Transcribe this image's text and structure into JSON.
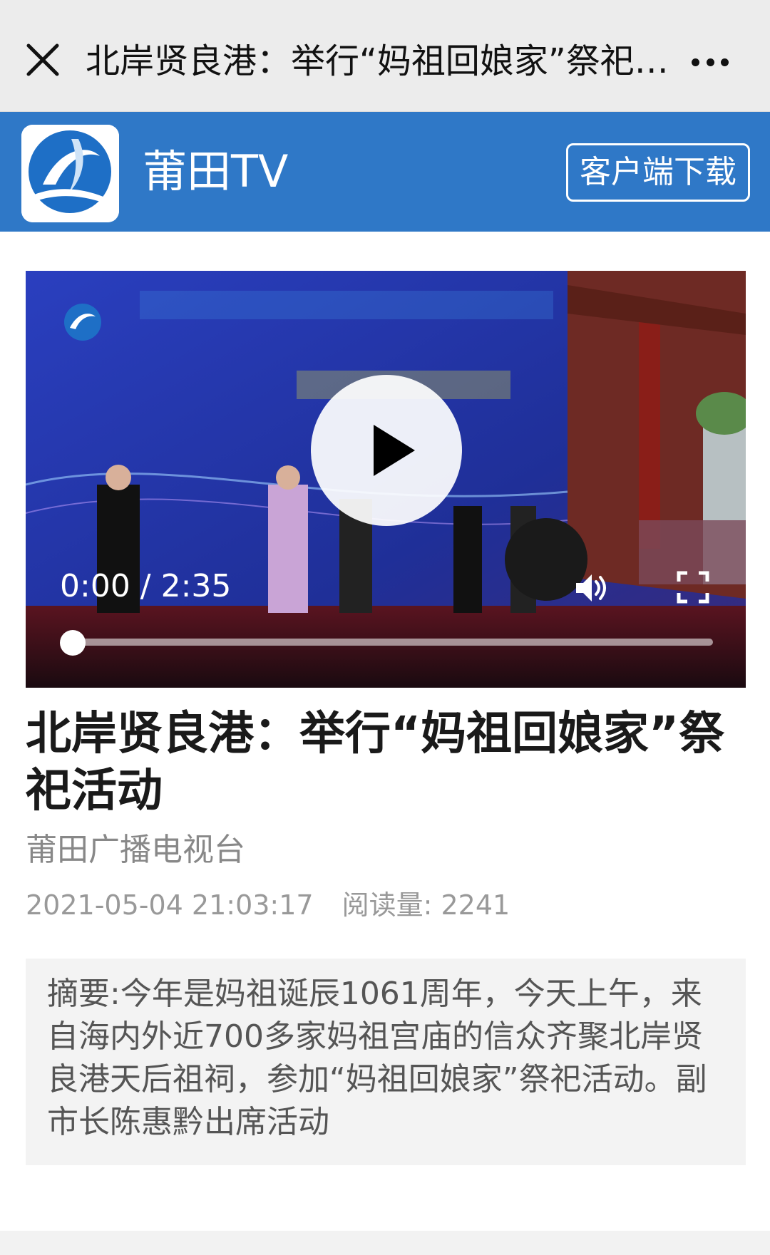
{
  "topbar": {
    "title": "北岸贤良港：举行“妈祖回娘家”祭祀活动"
  },
  "brand": {
    "name": "莆田TV",
    "download_label": "客户端下载",
    "color": "#2f78c7"
  },
  "video": {
    "time_display": "0:00 / 2:35",
    "current_seconds": 0,
    "duration_seconds": 155,
    "icons": [
      "play-icon",
      "volume-icon",
      "fullscreen-icon"
    ]
  },
  "article": {
    "title": "北岸贤良港：举行“妈祖回娘家”祭祀活动",
    "source": "莆田广播电视台",
    "datetime": "2021-05-04 21:03:17",
    "reads_label": "阅读量: 2241",
    "summary": "摘要:今年是妈祖诞辰1061周年，今天上午，来自海内外近700多家妈祖宫庙的信众齐聚北岸贤良港天后祖祠，参加“妈祖回娘家”祭祀活动。副市长陈惠黔出席活动"
  }
}
